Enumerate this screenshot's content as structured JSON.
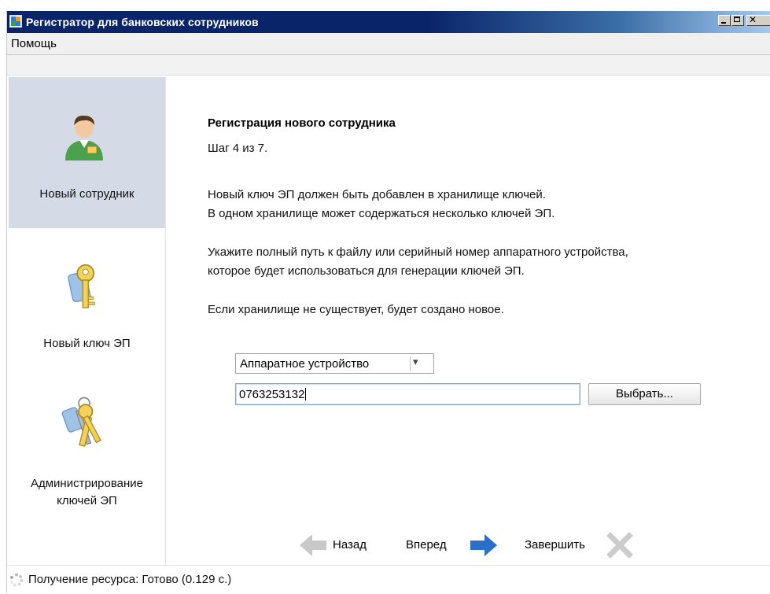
{
  "window": {
    "title": "Регистратор для банковских сотрудников",
    "menu": [
      "Помощь"
    ]
  },
  "sidebar": {
    "items": [
      {
        "label": "Новый сотрудник",
        "icon": "new-employee-icon",
        "active": true
      },
      {
        "label": "Новый ключ ЭП",
        "icon": "key-icon",
        "active": false
      },
      {
        "label_line1": "Администрирование",
        "label_line2": "ключей ЭП",
        "icon": "keys-bunch-icon",
        "active": false
      }
    ]
  },
  "content": {
    "heading": "Регистрация нового сотрудника",
    "step": "Шаг 4 из 7.",
    "para1_line1": "Новый ключ ЭП должен быть добавлен в хранилище ключей.",
    "para1_line2": "В одном хранилище может содержаться несколько ключей ЭП.",
    "para2_line1": "Укажите полный путь к файлу или серийный номер аппаратного устройства,",
    "para2_line2": "которое будет использоваться для генерации ключей ЭП.",
    "para3": "Если хранилище не существует, будет создано новое.",
    "storage_type": {
      "selected": "Аппаратное устройство"
    },
    "serial_input": {
      "value": "0763253132"
    },
    "choose_label": "Выбрать..."
  },
  "nav": {
    "back_label": "Назад",
    "next_label": "Вперед",
    "finish_label": "Завершить"
  },
  "status": {
    "text": "Получение ресурса: Готово (0.129 с.)"
  },
  "colors": {
    "titlebar": "#0a246a",
    "sidebar_active": "#d4dbe7",
    "accent_arrow": "#2a6fc9",
    "disabled": "#c8c8c8"
  }
}
